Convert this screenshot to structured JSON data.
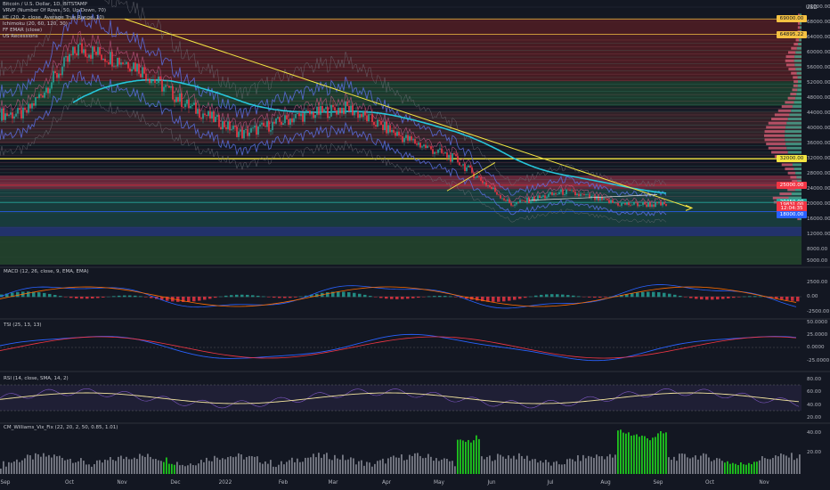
{
  "title": "Bitcoin / U.S. Dollar, 1D, BITSTAMP",
  "indicators": [
    "VRVP (Number Of Rows, 50, Up/Down, 70)",
    "KC (20, 2, close, Average True Range, 10)",
    "Ichimoku (20, 60, 120, 30)",
    "FF EMAR (close)",
    "US Recessions"
  ],
  "currency_label": "USD",
  "price_ticks": [
    "72000.00",
    "68000.00",
    "64000.00",
    "60000.00",
    "56000.00",
    "52000.00",
    "48000.00",
    "44000.00",
    "40000.00",
    "36000.00",
    "32000.00",
    "28000.00",
    "24000.00",
    "20000.00",
    "16000.00",
    "12000.00",
    "8000.00",
    "5000.00"
  ],
  "price_tags": [
    {
      "text": "69000.00",
      "value": 69000,
      "bg": "#f5c242"
    },
    {
      "text": "64895.22",
      "value": 64895,
      "bg": "#f5c242"
    },
    {
      "text": "32000.00",
      "value": 32000,
      "bg": "#f5e642"
    },
    {
      "text": "25000.00",
      "value": 25000,
      "bg": "#f23645"
    },
    {
      "text": "20450.00",
      "value": 20450,
      "bg": "#26a69a"
    },
    {
      "text": "19831.00",
      "value": 19831,
      "bg": "#f23645"
    },
    {
      "text": "12:04:35",
      "value": 18800,
      "bg": "#f23645"
    },
    {
      "text": "18000.00",
      "value": 17200,
      "bg": "#2962ff"
    }
  ],
  "x_ticks": [
    "Sep",
    "Oct",
    "Nov",
    "Dec",
    "2022",
    "Feb",
    "Mar",
    "Apr",
    "May",
    "Jun",
    "Jul",
    "Aug",
    "Sep",
    "Oct",
    "Nov"
  ],
  "colors": {
    "bg": "#131722",
    "up": "#26a69a",
    "down": "#f23645",
    "trend": "#f5e642",
    "ema": "#26c6da",
    "kc": "#5b6ee1",
    "macd": "#2962ff",
    "signal": "#ff6d00"
  },
  "panes": {
    "macd": {
      "label": "MACD (12, 26, close, 9, EMA, EMA)",
      "ticks": [
        "2500.00",
        "0.00",
        "-2500.00"
      ]
    },
    "tsi": {
      "label": "TSI (25, 13, 13)",
      "ticks": [
        "50.0000",
        "25.0000",
        "0.0000",
        "-25.0000"
      ]
    },
    "rsi": {
      "label": "RSI (14, close, SMA, 14, 2)",
      "ticks": [
        "80.00",
        "60.00",
        "40.00",
        "20.00"
      ]
    },
    "cm": {
      "label": "CM_Williams_Vix_Fix (22, 20, 2, 50, 0.85, 1.01)",
      "ticks": [
        "40.00",
        "20.00"
      ]
    }
  },
  "chart_data": {
    "type": "candlestick",
    "title": "Bitcoin / U.S. Dollar, 1D, BITSTAMP",
    "ylabel": "USD",
    "ylim": [
      4000,
      74000
    ],
    "x_range": [
      "2021-09-01",
      "2022-11-25"
    ],
    "monthly_close": [
      {
        "month": "2021-09",
        "close": 43800
      },
      {
        "month": "2021-10",
        "close": 61300
      },
      {
        "month": "2021-11",
        "close": 57000
      },
      {
        "month": "2021-12",
        "close": 46200
      },
      {
        "month": "2022-01",
        "close": 38500
      },
      {
        "month": "2022-02",
        "close": 43200
      },
      {
        "month": "2022-03",
        "close": 45500
      },
      {
        "month": "2022-04",
        "close": 37700
      },
      {
        "month": "2022-05",
        "close": 31800
      },
      {
        "month": "2022-06",
        "close": 19900
      },
      {
        "month": "2022-07",
        "close": 23300
      },
      {
        "month": "2022-08",
        "close": 20000
      },
      {
        "month": "2022-09",
        "close": 19831
      }
    ],
    "all_time_high": 69000,
    "horizontal_levels": [
      69000,
      64895.22,
      32000,
      25000,
      20450,
      18000
    ],
    "trendline": {
      "from": {
        "date": "2021-11-10",
        "price": 69000
      },
      "to": {
        "date": "2022-09-20",
        "price": 19000
      }
    },
    "grid": true
  }
}
